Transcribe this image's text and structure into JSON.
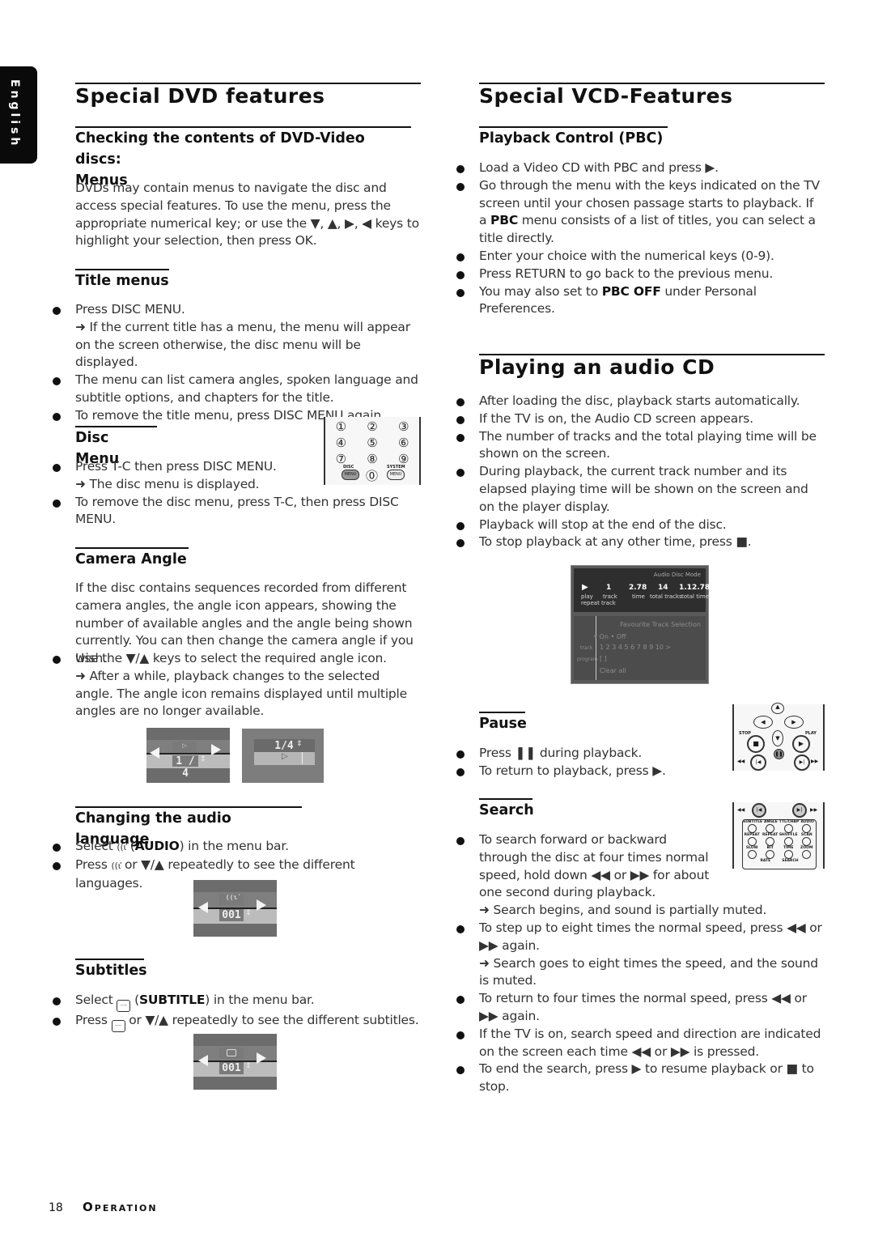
{
  "side_tab": "English",
  "left": {
    "title": "Special DVD features",
    "sections": {
      "menus": {
        "heading_line1": "Checking the contents of DVD-Video discs:",
        "heading_line2": "Menus",
        "body": "DVDs may contain menus to navigate the disc and access special features. To use the menu, press the appropriate numerical key; or use the ▼, ▲, ▶, ◀ keys to highlight your selection, then press OK."
      },
      "title_menus": {
        "heading": "Title menus",
        "items": [
          {
            "text": "Press DISC MENU.",
            "note": "➜ If the current title has a menu, the menu will appear on the screen otherwise, the disc menu will be displayed."
          },
          {
            "text": "The menu can list camera angles, spoken language and subtitle options, and chapters for the title."
          },
          {
            "text": "To remove the title menu, press DISC MENU again."
          }
        ]
      },
      "disc_menu": {
        "heading": "Disc Menu",
        "items": [
          {
            "text": "Press T-C then press DISC MENU.",
            "note": "➜ The disc menu is displayed."
          },
          {
            "text": "To remove the disc menu, press T-C, then press DISC MENU."
          }
        ],
        "keypad": {
          "keys": [
            "①",
            "②",
            "③",
            "④",
            "⑤",
            "⑥",
            "⑦",
            "⑧",
            "⑨",
            "⓪"
          ],
          "disc_label": "DISC",
          "system_label": "SYSTEM",
          "menu_label": "MENU"
        }
      },
      "camera_angle": {
        "heading": "Camera Angle",
        "body": "If the disc contains sequences recorded from different camera angles, the angle icon appears, showing the number of available angles and the angle being shown currently. You can then change the camera angle if you wish.",
        "items": [
          {
            "text": "Use the ▼/▲ keys to select the required angle icon.",
            "note": "➜ After a while, playback changes to the selected angle. The angle  icon remains displayed until multiple angles are no longer available."
          }
        ],
        "osd1_value": "1 / 4",
        "osd2_value": "1/4"
      },
      "audio_language": {
        "heading": "Changing the audio language",
        "items": [
          {
            "pre": "Select ",
            "icon": "((ɩ̕",
            "bold": "AUDIO",
            "post": ") in the menu bar."
          },
          {
            "pre": "Press ",
            "icon": "((ɩ̕",
            "post": " or ▼/▲ repeatedly to see the different languages."
          }
        ],
        "osd_value": "001"
      },
      "subtitles": {
        "heading": "Subtitles",
        "items": [
          {
            "pre": "Select ",
            "bold": "SUBTITLE",
            "post": ") in the menu bar."
          },
          {
            "pre": "Press ",
            "post": " or ▼/▲ repeatedly to see the different subtitles."
          }
        ],
        "osd_value": "001"
      }
    }
  },
  "right": {
    "title_vcd": "Special VCD-Features",
    "pbc": {
      "heading": "Playback Control (PBC)",
      "items": [
        "Load a Video CD with PBC and press ▶.",
        "Go through the menu with the keys indicated on the TV screen until your chosen passage starts to playback. If a",
        "menu consists of a list of titles, you can select a title directly.",
        "Enter your choice with the numerical keys (0-9).",
        "Press RETURN to go back to the previous menu.",
        "You may also set to",
        "under Personal Preferences."
      ],
      "bold_pbc": "PBC",
      "bold_pbc_off": "PBC OFF"
    },
    "title_audio": "Playing an audio CD",
    "audio_cd": {
      "items": [
        "After loading the disc, playback starts automatically.",
        "If the TV is on, the Audio CD screen appears.",
        "The number of tracks and the total playing time will be shown on the screen.",
        "During playback, the current track number and its elapsed playing time will be shown on the screen and on the player display.",
        "Playback will stop at the end of the disc.",
        "To stop playback at any other time, press ■."
      ],
      "screen": {
        "mode": "Audio Disc Mode",
        "play_label": "play",
        "repeat_label": "repeat track",
        "track_value": "1",
        "track_label": "track",
        "time_value": "2.78",
        "time_label": "time",
        "total_tracks_value": "14",
        "total_tracks_label": "total tracks",
        "total_time_value": "1.12.78",
        "total_time_label": "total time",
        "favourite": "Favourite Track Selection",
        "on_off": "▾ On  • Off",
        "track_row_label": "track",
        "track_numbers": "1  2  3  4  5  6  7  8  9  10  >",
        "program_label": "program",
        "program_value": "[ ]",
        "clear_all": "Clear all"
      }
    },
    "pause": {
      "heading": "Pause",
      "items": [
        "Press ❚❚ during playback.",
        "To return to playback, press ▶."
      ],
      "remote": {
        "stop": "STOP",
        "play": "PLAY"
      }
    },
    "search": {
      "heading": "Search",
      "items": [
        {
          "text": "To search forward or backward through the disc at four times normal speed, hold down ◀◀ or ▶▶ for about one second during playback.",
          "note": "➜ Search begins, and sound is partially muted."
        },
        {
          "text": "To step up to eight times the normal speed, press ◀◀ or ▶▶ again.",
          "note": "➜ Search goes to eight times the speed, and the sound is muted."
        },
        {
          "text": "To return to four times the normal speed, press ◀◀ or ▶▶ again."
        },
        {
          "text": "If the TV is on, search speed and direction are indicated on the screen each time ◀◀ or ▶▶ is pressed."
        },
        {
          "text": "To end the search, press ▶ to resume playback or ■ to stop."
        }
      ],
      "remote": {
        "row1": [
          "SUBTITLE",
          "ANGLE",
          "TTL/CHAP",
          "AUDIO"
        ],
        "row2": [
          "REPEAT",
          "REPEAT",
          "SHUFFLE",
          "SCAN"
        ],
        "row3": [
          "SLOW",
          "BIT",
          "TIME",
          "ZOOM"
        ],
        "row4": [
          "RATE",
          "SEARCH"
        ]
      }
    }
  },
  "footer": {
    "page": "18",
    "section": "Operation"
  }
}
